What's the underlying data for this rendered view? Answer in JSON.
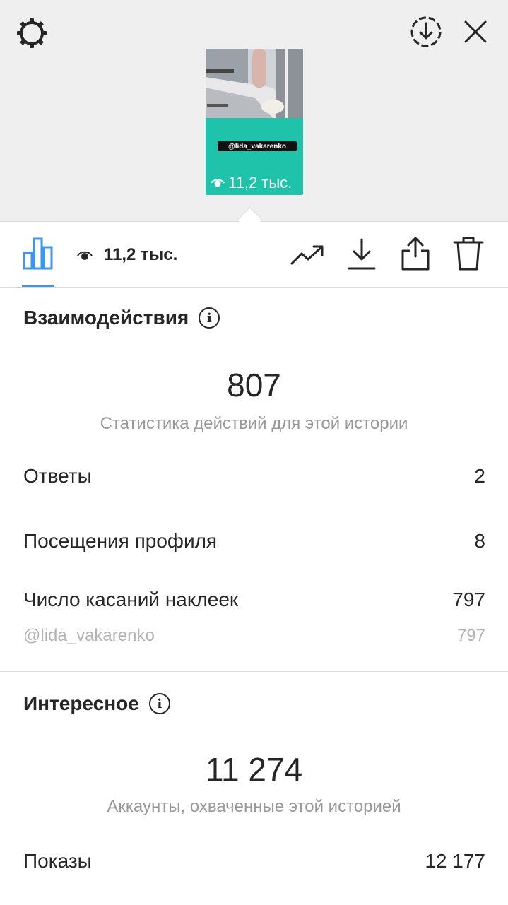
{
  "story": {
    "sticker_tag": "@lida_vakarenko",
    "views": "11,2 тыс."
  },
  "toolbar": {
    "views": "11,2 тыс.",
    "icons": [
      "bar-chart-icon",
      "eye-icon",
      "trending-icon",
      "download-icon",
      "share-icon",
      "trash-icon"
    ]
  },
  "interactions": {
    "title": "Взаимодействия",
    "total": "807",
    "caption": "Статистика действий для этой истории",
    "rows": [
      {
        "label": "Ответы",
        "value": "2"
      },
      {
        "label": "Посещения профиля",
        "value": "8"
      },
      {
        "label": "Число касаний наклеек",
        "value": "797"
      }
    ],
    "sub_row": {
      "label": "@lida_vakarenko",
      "value": "797"
    }
  },
  "discovery": {
    "title": "Интересное",
    "total": "11 274",
    "caption": "Аккаунты, охваченные этой историей",
    "rows": [
      {
        "label": "Показы",
        "value": "12 177"
      }
    ]
  },
  "colors": {
    "accent": "#3897f0",
    "story_bg": "#1fc3aa",
    "top_bg": "#efefef"
  }
}
